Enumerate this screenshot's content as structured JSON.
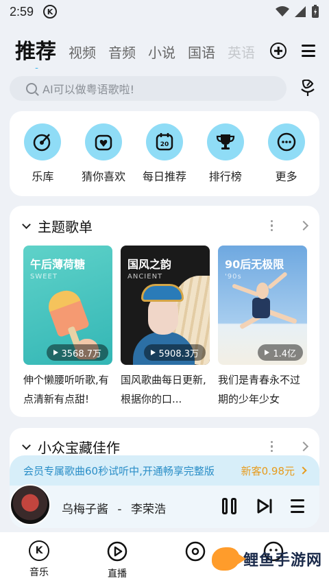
{
  "status_bar": {
    "time": "2:59",
    "app_badge": "K"
  },
  "tabs": [
    {
      "label": "推荐",
      "active": true
    },
    {
      "label": "视频"
    },
    {
      "label": "音频"
    },
    {
      "label": "小说"
    },
    {
      "label": "国语"
    },
    {
      "label": "英语"
    }
  ],
  "search": {
    "placeholder": "AI可以做粤语歌啦!"
  },
  "quick_entries": [
    {
      "label": "乐库",
      "icon": "music-library-icon"
    },
    {
      "label": "猜你喜欢",
      "icon": "heart-radio-icon"
    },
    {
      "label": "每日推荐",
      "icon": "calendar-20-icon",
      "badge": "20"
    },
    {
      "label": "排行榜",
      "icon": "trophy-icon"
    },
    {
      "label": "更多",
      "icon": "more-dots-icon"
    }
  ],
  "section_playlists": {
    "title": "主题歌单",
    "cards": [
      {
        "cover_title": "午后薄荷糖",
        "cover_sub": "SWEET",
        "plays": "3568.7万",
        "desc": "伸个懒腰听听歌,有点清新有点甜!"
      },
      {
        "cover_title": "国风之韵",
        "cover_sub": "ANCIENT",
        "plays": "5908.3万",
        "desc": "国风歌曲每日更新,根据你的口..."
      },
      {
        "cover_title": "90后无极限",
        "cover_sub": "'90s",
        "plays": "1.4亿",
        "desc": "我们是青春永不过期的少年少女"
      }
    ]
  },
  "section_hidden": {
    "title": "小众宝藏佳作"
  },
  "vip_banner": {
    "text": "会员专属歌曲60秒试听中,开通畅享完整版",
    "offer": "新客0.98元"
  },
  "player": {
    "song": "乌梅子酱",
    "separator": "-",
    "artist": "李荣浩"
  },
  "bottom_nav": [
    {
      "label": "音乐",
      "icon": "K"
    },
    {
      "label": "直播",
      "icon": ""
    }
  ],
  "watermark": {
    "text": "鲤鱼手游网"
  },
  "colors": {
    "accent": "#1aa8e8",
    "quick_icon_bg": "#8fdcf6",
    "vip_text": "#2a8ec7",
    "offer": "#e79b1c"
  }
}
